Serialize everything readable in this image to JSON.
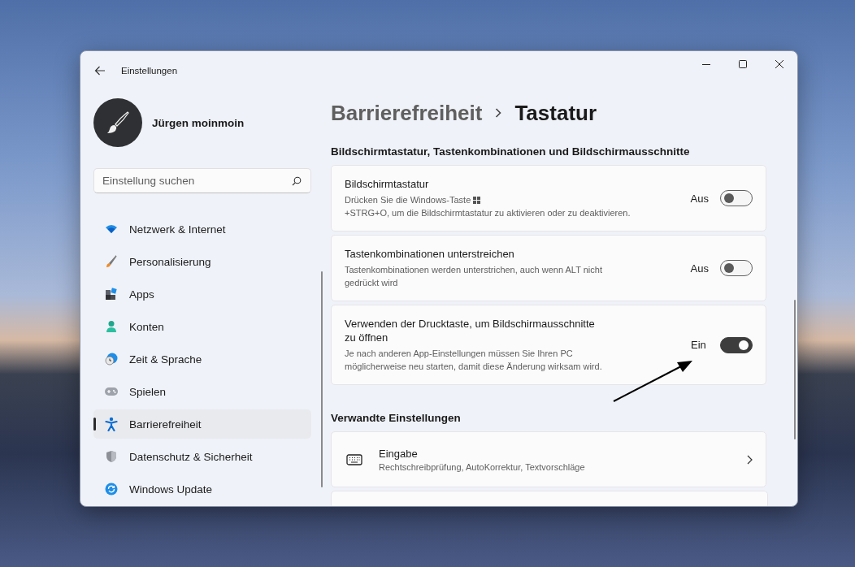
{
  "window": {
    "title": "Einstellungen"
  },
  "user": {
    "name": "Jürgen moinmoin"
  },
  "search": {
    "placeholder": "Einstellung suchen"
  },
  "sidebar": {
    "items": [
      {
        "label": "Netzwerk & Internet",
        "kind": "wifi",
        "selected": false
      },
      {
        "label": "Personalisierung",
        "kind": "brush",
        "selected": false
      },
      {
        "label": "Apps",
        "kind": "apps",
        "selected": false
      },
      {
        "label": "Konten",
        "kind": "person",
        "selected": false
      },
      {
        "label": "Zeit & Sprache",
        "kind": "clock",
        "selected": false
      },
      {
        "label": "Spielen",
        "kind": "gamepad",
        "selected": false
      },
      {
        "label": "Barrierefreiheit",
        "kind": "accessibility",
        "selected": true
      },
      {
        "label": "Datenschutz & Sicherheit",
        "kind": "shield",
        "selected": false
      },
      {
        "label": "Windows Update",
        "kind": "update",
        "selected": false
      }
    ]
  },
  "breadcrumb": {
    "parent": "Barrierefreiheit",
    "current": "Tastatur"
  },
  "section": {
    "heading": "Bildschirmtastatur, Tastenkombinationen und Bildschirmausschnitte",
    "settings": [
      {
        "title": "Bildschirmtastatur",
        "description": [
          {
            "kind": "text",
            "text": "Drücken Sie die Windows-Taste"
          },
          {
            "kind": "windows-key"
          },
          {
            "kind": "text",
            "text": "+STRG+O, um die Bildschirmtastatur zu aktivieren oder zu deaktivieren."
          }
        ],
        "state_label": "Aus",
        "on": false
      },
      {
        "title": "Tastenkombinationen unterstreichen",
        "description": [
          {
            "kind": "text",
            "text": "Tastenkombinationen werden unterstrichen, auch wenn ALT nicht gedrückt wird"
          }
        ],
        "state_label": "Aus",
        "on": false
      },
      {
        "title": "Verwenden der Drucktaste, um Bildschirmausschnitte zu öffnen",
        "description": [
          {
            "kind": "text",
            "text": "Je nach anderen App-Einstellungen müssen Sie Ihren PC möglicherweise neu starten, damit diese Änderung wirksam wird."
          }
        ],
        "state_label": "Ein",
        "on": true
      }
    ]
  },
  "related": {
    "heading": "Verwandte Einstellungen",
    "links": [
      {
        "title": "Eingabe",
        "description": "Rechtschreibprüfung, AutoKorrektur, Textvorschläge",
        "kind": "keyboard"
      }
    ]
  }
}
